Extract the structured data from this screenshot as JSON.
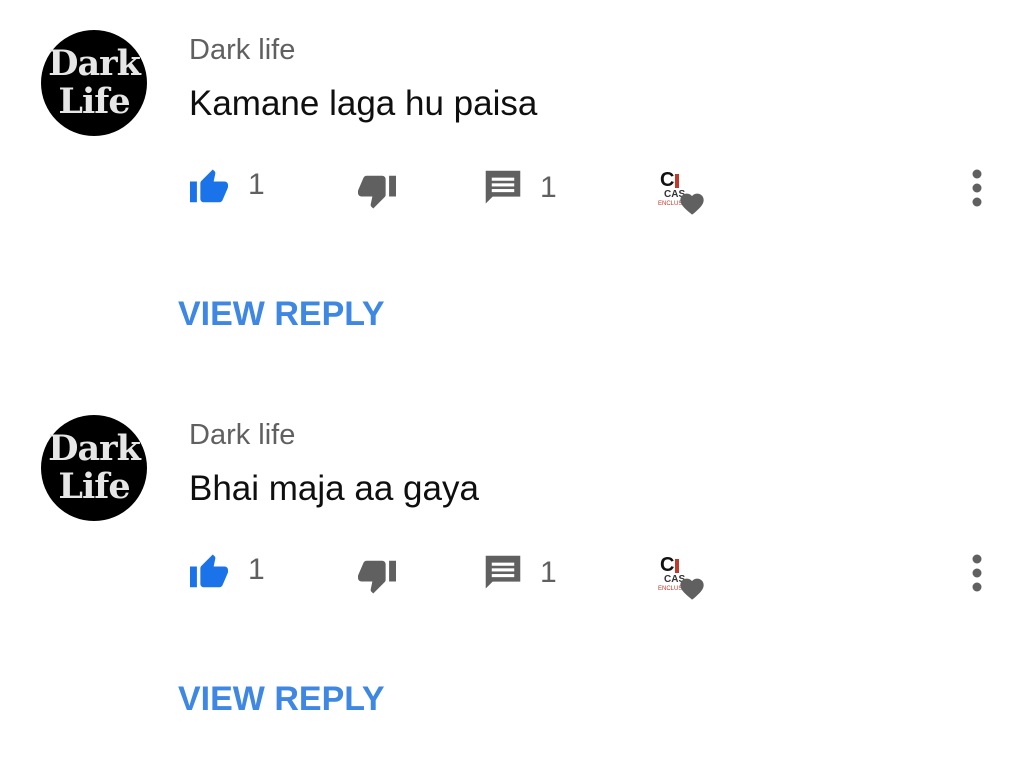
{
  "comments": [
    {
      "avatar": {
        "line1": "Dark",
        "line2": "Life"
      },
      "author": "Dark life",
      "text": "Kamane laga hu paisa",
      "like_count": "1",
      "reply_count": "1",
      "view_reply_label": "VIEW REPLY"
    },
    {
      "avatar": {
        "line1": "Dark",
        "line2": "Life"
      },
      "author": "Dark life",
      "text": "Bhai maja aa gaya",
      "like_count": "1",
      "reply_count": "1",
      "view_reply_label": "VIEW REPLY"
    }
  ],
  "creator_badge": {
    "letter": "C",
    "sub": "CAS",
    "tiny": "ENCLUSIN"
  },
  "icons": {
    "like": "thumbs-up-icon",
    "dislike": "thumbs-down-icon",
    "reply": "comment-icon",
    "creator_heart": "creator-heart-icon",
    "more": "more-vert-icon"
  },
  "colors": {
    "like_active": "#1a73e8",
    "icon_gray": "#606060",
    "link_blue": "#3e87e2"
  }
}
